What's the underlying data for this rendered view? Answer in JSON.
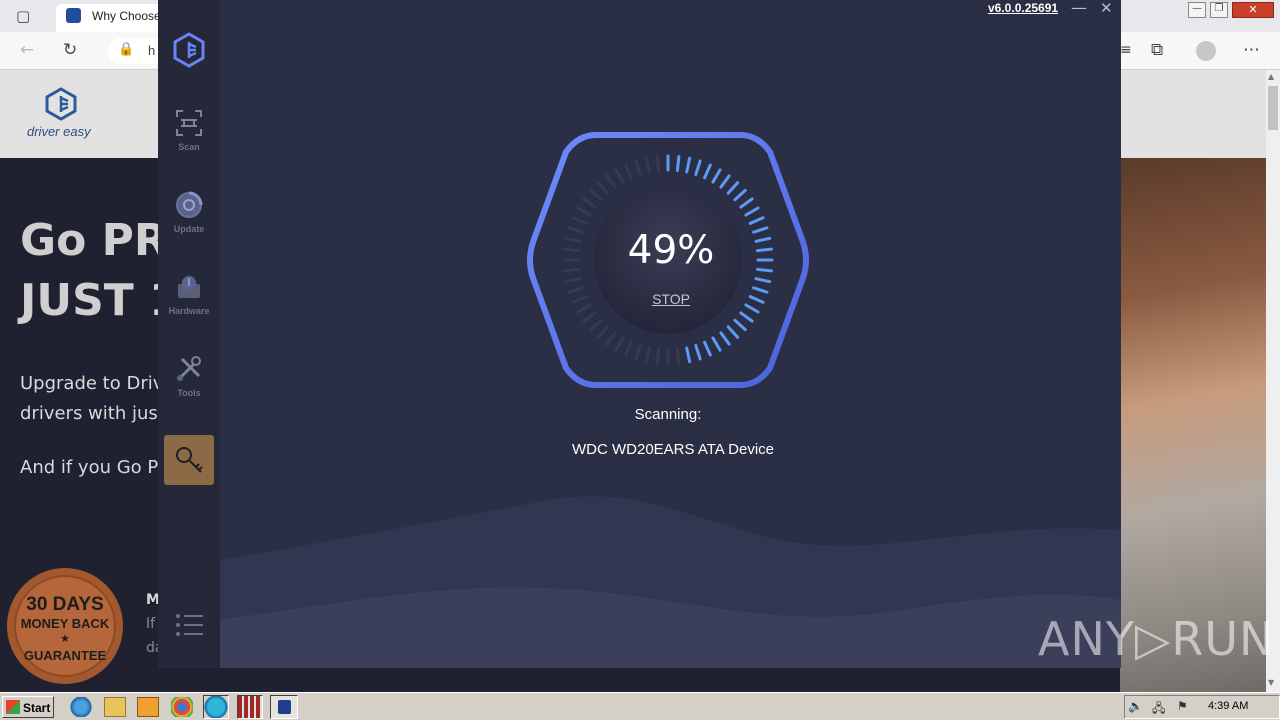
{
  "browser": {
    "tab_title": "Why Choose",
    "address_fragment": "h"
  },
  "website": {
    "logo_text": "driver easy",
    "hero_line1": "Go PR",
    "hero_line2": "JUST 1",
    "para1_line1": "Upgrade to Driv",
    "para1_line2": "drivers with just",
    "para2": "And if you Go P",
    "badge_days": "30 DAYS",
    "badge_money": "MONEY BACK",
    "badge_star": "★",
    "badge_guarantee": "GUARANTEE",
    "side_m": "M",
    "side_if": "If",
    "side_da": "da"
  },
  "app": {
    "version": "v6.0.0.25691",
    "nav": [
      {
        "label": "Scan"
      },
      {
        "label": "Update"
      },
      {
        "label": "Hardware"
      },
      {
        "label": "Tools"
      }
    ],
    "progress_percent": 49,
    "progress_text": "49%",
    "stop_label": "STOP",
    "scanning_label": "Scanning:",
    "scanning_device": "WDC WD20EARS ATA Device",
    "colors": {
      "background": "#2b2f45",
      "sidebar": "#252838",
      "accent": "#5b7cf2",
      "license_button": "#8c6a45"
    }
  },
  "taskbar": {
    "start_label": "Start",
    "clock": "4:39 AM"
  },
  "watermark": "ANY▷RUN"
}
